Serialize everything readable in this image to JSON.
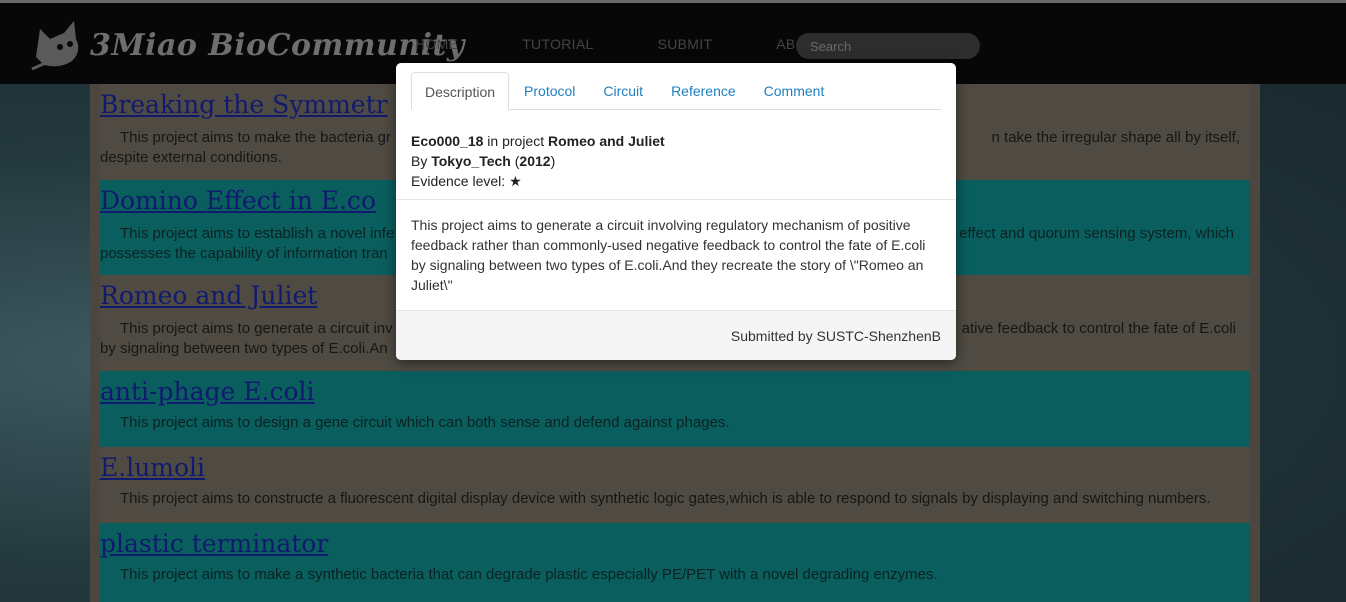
{
  "site": {
    "logo_text": "3Miao BioCommunity",
    "nav": [
      "HOME",
      "TUTORIAL",
      "SUBMIT",
      "ABOUT"
    ],
    "search_placeholder": "Search"
  },
  "projects": [
    {
      "title": "Breaking the Symmetr",
      "desc": "This project aims to make the bacteria gr",
      "desc_right": "n take the irregular shape all by itself,",
      "desc_line2": "despite external conditions."
    },
    {
      "title": "Domino Effect in E.co",
      "desc": "This project aims to establish a novel infe",
      "desc_right": "effect and quorum sensing system, which",
      "desc_line2": "possesses the capability of information tran"
    },
    {
      "title": "Romeo and Juliet",
      "desc": "This project aims to generate a circuit inv",
      "desc_right": "ative feedback to control the fate of E.coli",
      "desc_line2": "by signaling between two types of E.coli.An"
    },
    {
      "title": "anti-phage E.coli",
      "desc": "This project aims to design a gene circuit which can both sense and defend against phages."
    },
    {
      "title": "E.lumoli",
      "desc": "This project aims to constructe a fluorescent digital display device with synthetic logic gates,which is able to respond to signals by displaying and switching numbers."
    },
    {
      "title": "plastic terminator",
      "desc": "This project aims to make a synthetic bacteria that can degrade plastic especially PE/PET with a novel degrading enzymes."
    }
  ],
  "modal": {
    "tabs": [
      "Description",
      "Protocol",
      "Circuit",
      "Reference",
      "Comment"
    ],
    "active_tab": "Description",
    "part_id": "Eco000_18",
    "in_project_text": " in project ",
    "project_name": "Romeo and Juliet",
    "by_text": "By ",
    "team": "Tokyo_Tech",
    "year": "2012",
    "evidence_label": "Evidence level: ",
    "evidence_stars": "★",
    "description": "This project aims to generate a circuit involving regulatory mechanism of positive feedback rather than commonly-used negative feedback to control the fate of E.coli by signaling between two types of E.coli.And they recreate the story of \\\"Romeo an Juliet\\\"",
    "submitted_by": "Submitted by SUSTC-ShenzhenB"
  }
}
